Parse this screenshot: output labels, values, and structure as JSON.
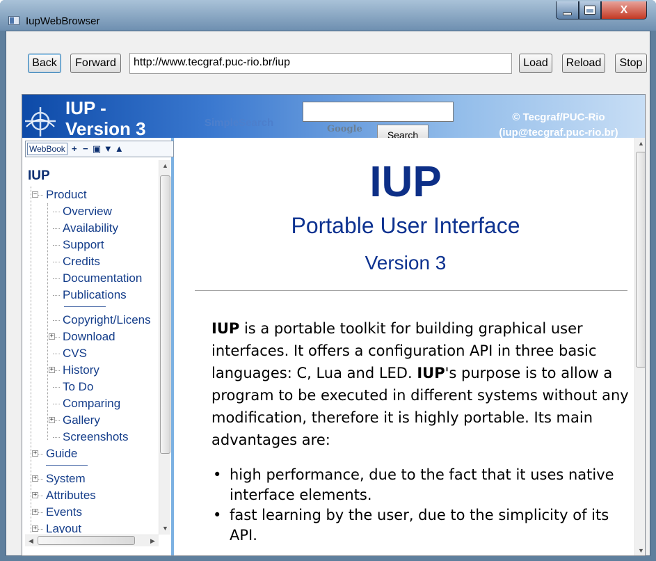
{
  "window": {
    "title": "IupWebBrowser",
    "controls": {
      "minimize_icon": "minimize-icon",
      "maximize_icon": "maximize-icon",
      "close_glyph": "X"
    }
  },
  "toolbar": {
    "back_label": "Back",
    "forward_label": "Forward",
    "url_value": "http://www.tecgraf.puc-rio.br/iup",
    "load_label": "Load",
    "reload_label": "Reload",
    "stop_label": "Stop"
  },
  "banner": {
    "title_line1": "IUP -",
    "title_line2": "Version 3",
    "simple_search": "SimpleSearch",
    "search_value": "",
    "google_label": "Google",
    "search_button": "Search",
    "copyright_line1": "© Tecgraf/PUC-Rio",
    "copyright_line2": "(iup@tecgraf.puc-rio.br)"
  },
  "webbook": {
    "label": "WebBook",
    "toolbar_icons": [
      "expand-all-icon",
      "collapse-all-icon",
      "sync-icon",
      "next-icon",
      "previous-icon"
    ]
  },
  "tree": {
    "root": "IUP",
    "items": [
      {
        "label": "Product",
        "level": 0,
        "expander": "minus"
      },
      {
        "label": "Overview",
        "level": 1
      },
      {
        "label": "Availability",
        "level": 1
      },
      {
        "label": "Support",
        "level": 1
      },
      {
        "label": "Credits",
        "level": 1
      },
      {
        "label": "Documentation",
        "level": 1
      },
      {
        "label": "Publications",
        "level": 1
      },
      {
        "label": "Copyright/Licens",
        "level": 1
      },
      {
        "label": "Download",
        "level": 1,
        "expander": "plus"
      },
      {
        "label": "CVS",
        "level": 1
      },
      {
        "label": "History",
        "level": 1,
        "expander": "plus"
      },
      {
        "label": "To Do",
        "level": 1
      },
      {
        "label": "Comparing",
        "level": 1
      },
      {
        "label": "Gallery",
        "level": 1,
        "expander": "plus"
      },
      {
        "label": "Screenshots",
        "level": 1
      },
      {
        "label": "Guide",
        "level": 0,
        "expander": "plus"
      },
      {
        "label": "System",
        "level": 0,
        "expander": "plus"
      },
      {
        "label": "Attributes",
        "level": 0,
        "expander": "plus"
      },
      {
        "label": "Events",
        "level": 0,
        "expander": "plus"
      },
      {
        "label": "Layout",
        "level": 0,
        "expander": "plus"
      }
    ]
  },
  "content": {
    "heading": "IUP",
    "subtitle": "Portable User Interface",
    "version": "Version 3",
    "intro_bold1": "IUP",
    "intro_text1": " is a portable toolkit for building graphical user interfaces. It offers a configuration API in three basic languages: C, Lua and LED. ",
    "intro_bold2": "IUP",
    "intro_text2": "'s purpose is to allow a program to be executed in different systems without any modification, therefore it is highly portable. Its main advantages are:",
    "bullets": [
      "high performance, due to the fact that it uses native interface elements.",
      "fast learning by the user, due to the simplicity of its API."
    ]
  }
}
